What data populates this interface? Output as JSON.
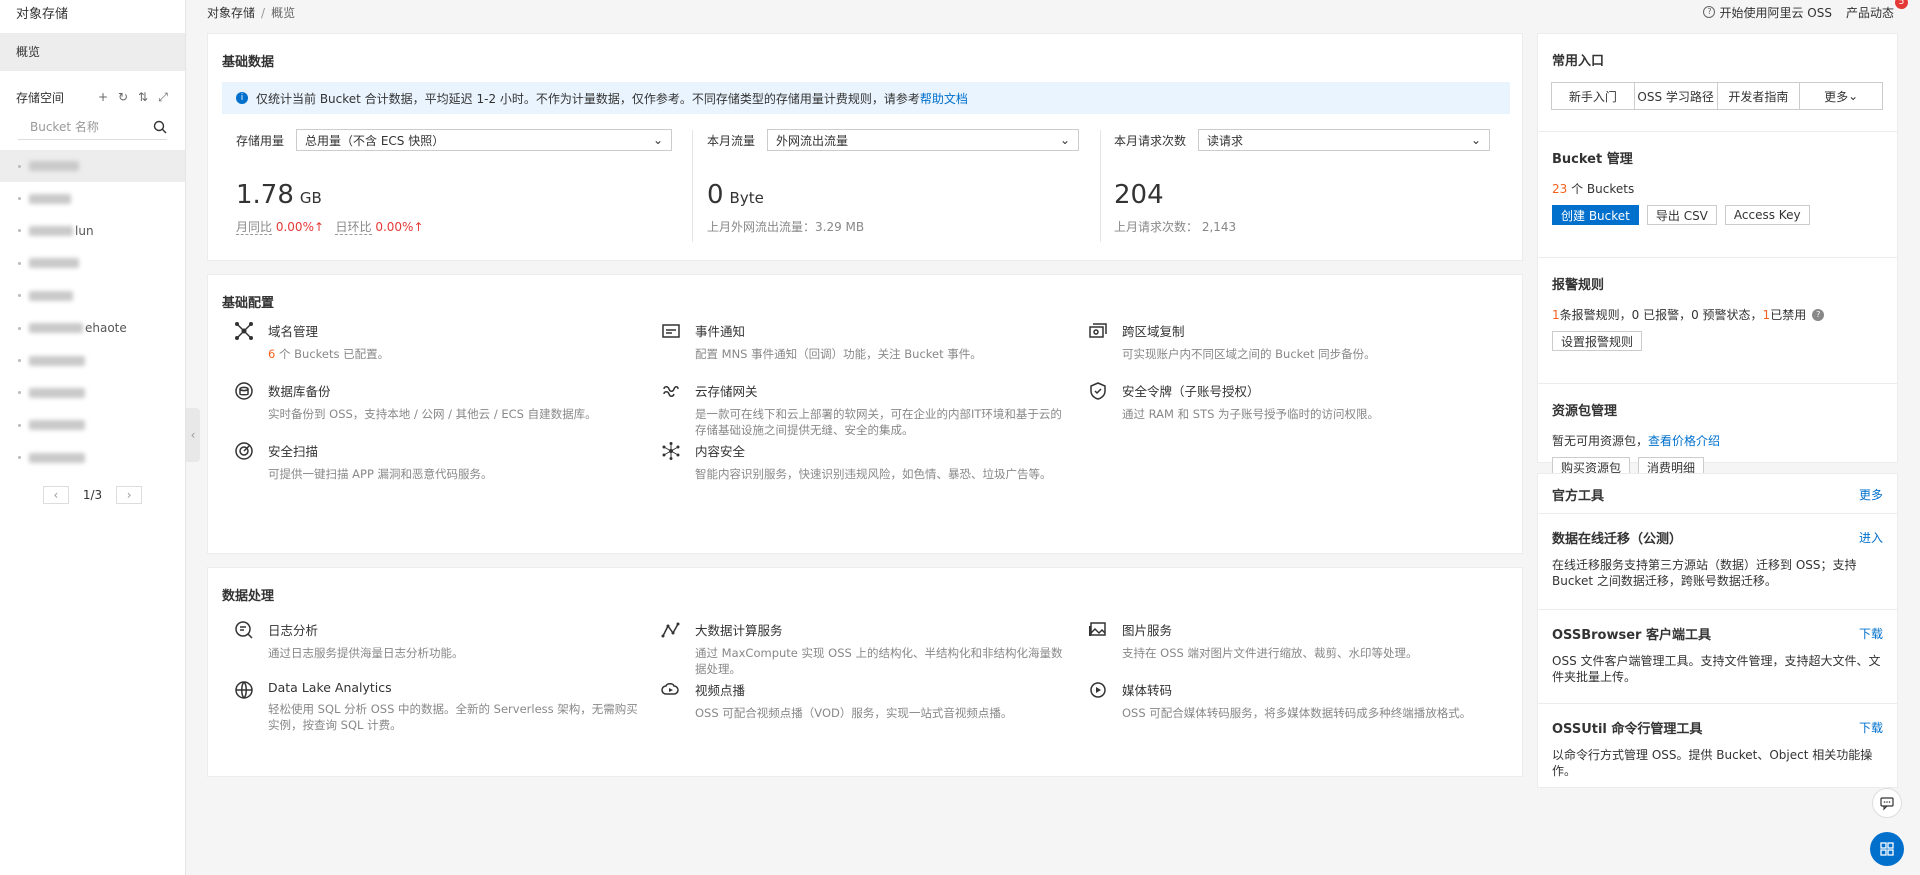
{
  "sidebar": {
    "title": "对象存储",
    "overview": "概览",
    "space_label": "存储空间",
    "search_placeholder": "Bucket 名称",
    "buckets": [
      {
        "visible": "",
        "w": 50
      },
      {
        "visible": "",
        "w": 42
      },
      {
        "visible": "lun",
        "w": 44
      },
      {
        "visible": "",
        "w": 50
      },
      {
        "visible": "",
        "w": 44
      },
      {
        "visible": "ehaote",
        "w": 54
      },
      {
        "visible": "",
        "w": 56
      },
      {
        "visible": "",
        "w": 56
      },
      {
        "visible": "",
        "w": 56
      },
      {
        "visible": "",
        "w": 56
      }
    ],
    "page_indicator": "1/3"
  },
  "topbar": {
    "crumb_root": "对象存储",
    "crumb_current": "概览",
    "start_oss": "开始使用阿里云 OSS",
    "news": "产品动态",
    "news_badge": "5"
  },
  "basic_data": {
    "title": "基础数据",
    "notice_text": "仅统计当前 Bucket 合计数据，平均延迟 1-2 小时。不作为计量数据，仅作参考。不同存储类型的存储用量计费规则，请参考",
    "notice_link": "帮助文档",
    "storage": {
      "label": "存储用量",
      "select": "总用量（不含 ECS 快照）",
      "value": "1.78",
      "unit": "GB",
      "mom_label": "月同比",
      "mom_value": "0.00%",
      "dod_label": "日环比",
      "dod_value": "0.00%"
    },
    "traffic": {
      "label": "本月流量",
      "select": "外网流出流量",
      "value": "0",
      "unit": "Byte",
      "foot": "上月外网流出流量：3.29 MB"
    },
    "requests": {
      "label": "本月请求次数",
      "select": "读请求",
      "value": "204",
      "foot": "上月请求次数： 2,143"
    }
  },
  "basic_config": {
    "title": "基础配置",
    "items": [
      {
        "title": "域名管理",
        "count": "6",
        "desc_suffix": " 个 Buckets 已配置。",
        "icon": "domain-icon"
      },
      {
        "title": "事件通知",
        "desc": "配置 MNS 事件通知（回调）功能，关注 Bucket 事件。",
        "icon": "event-icon"
      },
      {
        "title": "跨区域复制",
        "desc": "可实现账户内不同区域之间的 Bucket 同步备份。",
        "icon": "replication-icon"
      },
      {
        "title": "数据库备份",
        "desc": "实时备份到 OSS，支持本地 / 公网 / 其他云 / ECS 自建数据库。",
        "icon": "db-backup-icon"
      },
      {
        "title": "云存储网关",
        "desc": "是一款可在线下和云上部署的软网关，可在企业的内部IT环境和基于云的存储基础设施之间提供无缝、安全的集成。",
        "icon": "gateway-icon"
      },
      {
        "title": "安全令牌（子账号授权）",
        "desc": "通过 RAM 和 STS 为子账号授予临时的访问权限。",
        "icon": "token-icon"
      },
      {
        "title": "安全扫描",
        "desc": "可提供一键扫描 APP 漏洞和恶意代码服务。",
        "icon": "scan-icon"
      },
      {
        "title": "内容安全",
        "desc": "智能内容识别服务，快速识别违规风险，如色情、暴恐、垃圾广告等。",
        "icon": "content-security-icon"
      }
    ]
  },
  "data_proc": {
    "title": "数据处理",
    "items": [
      {
        "title": "日志分析",
        "desc": "通过日志服务提供海量日志分析功能。",
        "icon": "log-icon"
      },
      {
        "title": "大数据计算服务",
        "desc": "通过 MaxCompute 实现 OSS 上的结构化、半结构化和非结构化海量数据处理。",
        "icon": "bigdata-icon"
      },
      {
        "title": "图片服务",
        "desc": "支持在 OSS 端对图片文件进行缩放、裁剪、水印等处理。",
        "icon": "image-icon"
      },
      {
        "title": "Data Lake Analytics",
        "desc": "轻松使用 SQL 分析 OSS 中的数据。全新的 Serverless 架构，无需购买实例，按查询 SQL 计费。",
        "icon": "dla-icon"
      },
      {
        "title": "视频点播",
        "desc": "OSS 可配合视频点播（VOD）服务，实现一站式音视频点播。",
        "icon": "vod-icon"
      },
      {
        "title": "媒体转码",
        "desc": "OSS 可配合媒体转码服务，将多媒体数据转码成多种终端播放格式。",
        "icon": "transcode-icon"
      }
    ]
  },
  "entry": {
    "title": "常用入口",
    "tabs": [
      "新手入门",
      "OSS 学习路径",
      "开发者指南",
      "更多"
    ],
    "bucket_mgmt": {
      "title": "Bucket 管理",
      "count": "23",
      "count_suffix": " 个 Buckets",
      "create": "创建 Bucket",
      "export": "导出 CSV",
      "access_key": "Access Key"
    },
    "alert": {
      "title": "报警规则",
      "n1": "1",
      "t1": " 条报警规则，0 已报警，0 预警状态，",
      "n2": "1",
      "t2": " 已禁用",
      "btn": "设置报警规则"
    },
    "package": {
      "title": "资源包管理",
      "text": "暂无可用资源包，",
      "link": "查看价格介绍",
      "buy": "购买资源包",
      "detail": "消费明细"
    }
  },
  "tools": {
    "title": "官方工具",
    "more": "更多",
    "items": [
      {
        "title": "数据在线迁移（公测）",
        "action": "进入",
        "desc": "在线迁移服务支持第三方源站（数据）迁移到 OSS；支持 Bucket 之间数据迁移，跨账号数据迁移。"
      },
      {
        "title": "OSSBrowser 客户端工具",
        "action": "下载",
        "desc": "OSS 文件客户端管理工具。支持文件管理，支持超大文件、文件夹批量上传。"
      },
      {
        "title": "OSSUtil 命令行管理工具",
        "action": "下载",
        "desc": "以命令行方式管理 OSS。提供 Bucket、Object 相关功能操作。"
      }
    ]
  },
  "colors": {
    "accent": "#0070cc",
    "warn": "#f5621d",
    "danger": "#e53935"
  }
}
